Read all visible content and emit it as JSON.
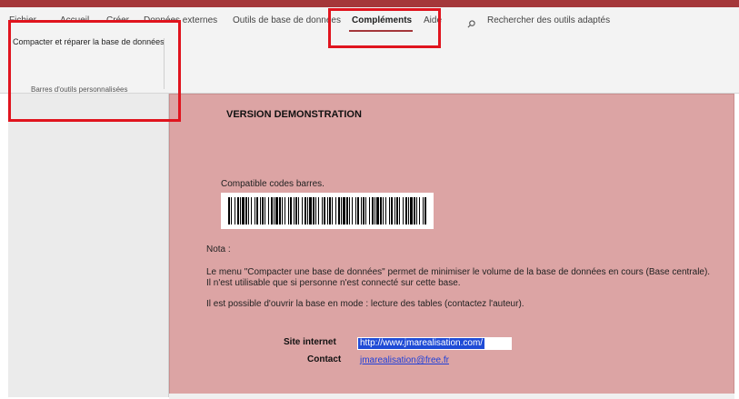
{
  "tabs": [
    {
      "label": "Fichier"
    },
    {
      "label": "Accueil"
    },
    {
      "label": "Créer"
    },
    {
      "label": "Données externes"
    },
    {
      "label": "Outils de base de données"
    },
    {
      "label": "Compléments",
      "active": true
    },
    {
      "label": "Aide"
    }
  ],
  "search": {
    "label": "Rechercher des outils adaptés",
    "icon": "search-icon"
  },
  "ribbon": {
    "button_label": "Compacter et réparer la base de données",
    "group_label": "Barres d'outils personnalisées"
  },
  "form": {
    "title": "VERSION DEMONSTRATION",
    "barcode_caption": "Compatible codes barres.",
    "nota": "Nota :",
    "paragraph1": "Le menu \"Compacter une base de données\" permet de minimiser le volume de la base de données en cours (Base centrale). Il n'est utilisable que si personne n'est connecté sur cette base.",
    "paragraph2": "Il est possible d'ouvrir la base en mode : lecture des tables (contactez l'auteur).",
    "site_label": "Site internet",
    "site_url": "http://www.jmarealisation.com/",
    "contact_label": "Contact",
    "contact_email": "jmarealisation@free.fr"
  },
  "colors": {
    "accent": "#a4373a",
    "form_bg": "#dca4a4",
    "highlight": "#e0141e",
    "link": "#1f3fd8"
  }
}
